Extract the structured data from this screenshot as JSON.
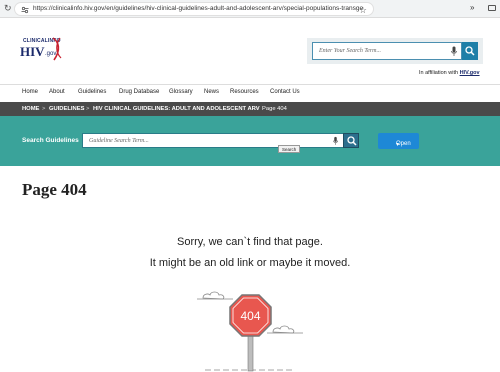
{
  "browser": {
    "url": "https://clinicalinfo.hiv.gov/en/guidelines/hiv-clinical-guidelines-adult-and-adolescent-arv/special-populations-transgend..."
  },
  "logo": {
    "small_text": "CLINICALINFO",
    "main_text": "HIV",
    "suffix": ".gov"
  },
  "site_search": {
    "placeholder": "Enter Your Search Term..."
  },
  "affiliation": {
    "prefix": "In affiliation with",
    "link": "HIV.gov"
  },
  "nav": {
    "items": [
      "Home",
      "About",
      "Guidelines",
      "Drug Database",
      "Glossary",
      "News",
      "Resources",
      "Contact Us"
    ]
  },
  "breadcrumb": {
    "items": [
      "HOME",
      "GUIDELINES",
      "HIV CLINICAL GUIDELINES: ADULT AND ADOLESCENT ARV",
      "Page 404"
    ],
    "separator": ">"
  },
  "guideline_search": {
    "label": "Search Guidelines",
    "placeholder": "Guideline Search Term...",
    "tooltip": "Search",
    "open_label": "Open"
  },
  "content": {
    "title": "Page 404",
    "message_line1": "Sorry, we can`t find that page.",
    "message_line2": "It might be an old link or maybe it moved.",
    "sign_text": "404"
  },
  "colors": {
    "nav_dark": "#4a4a4a",
    "teal": "#3aa39a",
    "open_blue": "#1e88d6",
    "stop_red": "#e8574f"
  }
}
